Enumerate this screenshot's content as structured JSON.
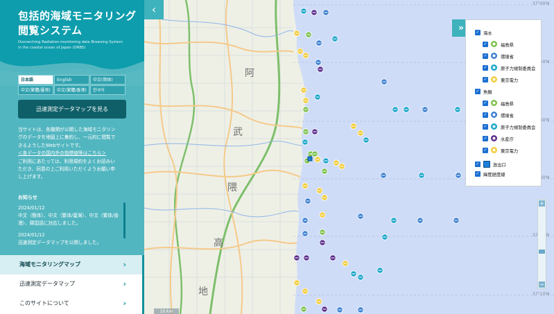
{
  "header": {
    "title_line1": "包括的海域モニタリング",
    "title_line2": "閲覧システム",
    "subtitle_line1": "Overarching Radiation-monitoring data Browsing System",
    "subtitle_line2": "in the coastal ocean of Japan (ORBS)"
  },
  "languages": [
    [
      "日本語",
      "English",
      "中文(简体)"
    ],
    [
      "中文(繁體/臺灣)",
      "中文(繁體/香港)",
      "한국어"
    ]
  ],
  "active_language": "日本語",
  "quick_map_button": "迅速測定データマップを見る",
  "intro": {
    "line1": "当サイトは、各機関が公開した海域モニタリン",
    "line2": "グのデータを地図上に集約し、一元的に閲覧で",
    "line3": "きるようしたWebサイトです。",
    "line4_link": "＜各データの国内外の指標値等はこちら＞",
    "line5": "ご利用にあたっては、利用規約をよくお読みい",
    "line6": "ただき、同意の上ご利用いただくようお願い申",
    "line7": "し上げます。"
  },
  "news": {
    "title": "お知らせ",
    "items": [
      {
        "date": "2024/01/12",
        "text": "中文（簡体）、中文（繁体/臺灣）、中文（繁体/香港）、韓国語に対応しました。"
      },
      {
        "date": "2024/01/12",
        "text": "迅速測定データマップを公開しました。"
      }
    ]
  },
  "nav": [
    {
      "label": "海域モニタリングマップ",
      "active": true
    },
    {
      "label": "迅速測定データマップ",
      "active": false
    },
    {
      "label": "このサイトについて",
      "active": false
    }
  ],
  "layers": {
    "seawater_label": "海水",
    "seawater": [
      {
        "label": "福島県",
        "icon": "green-circle",
        "color": "#7cc04b"
      },
      {
        "label": "環境省",
        "icon": "blue-circle",
        "color": "#3a7fd0"
      },
      {
        "label": "原子力規制委員会",
        "icon": "cyan-circle",
        "color": "#1aa6c9"
      },
      {
        "label": "東京電力",
        "icon": "yellow-circle",
        "color": "#f2cc3a"
      }
    ],
    "fish_label": "魚類",
    "fish": [
      {
        "label": "福島県",
        "icon": "green-circle",
        "color": "#7cc04b"
      },
      {
        "label": "環境省",
        "icon": "blue-circle",
        "color": "#3a7fd0"
      },
      {
        "label": "原子力規制委員会",
        "icon": "cyan-circle",
        "color": "#1aa6c9"
      },
      {
        "label": "水産庁",
        "icon": "purple-circle",
        "color": "#5a2d8a"
      },
      {
        "label": "東京電力",
        "icon": "yellow-circle",
        "color": "#f2cc3a"
      }
    ],
    "outlet_label": "放出口",
    "graticule_label": "緯度経度線"
  },
  "coords": {
    "c1": "37°00'N",
    "c2": "37°50'N",
    "c3": "37°40'N",
    "c4": "37°30'N",
    "c5": "37°20'N",
    "c6": "37°10'N"
  },
  "map_labels": {
    "chars": [
      "阿",
      "武",
      "隈",
      "高",
      "地"
    ]
  },
  "scale_text": "10 km",
  "colors": {
    "teal": "#0d9dad",
    "sea": "#cfdcf8",
    "land": "#eef0e6",
    "road": "#f5c98a"
  }
}
